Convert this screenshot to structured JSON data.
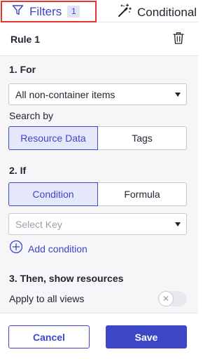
{
  "tabs": {
    "filters": {
      "label": "Filters",
      "count": "1",
      "icon": "funnel-icon"
    },
    "conditional": {
      "label": "Conditional",
      "icon": "magic-wand-icon"
    }
  },
  "rule": {
    "title": "Rule 1",
    "delete_icon": "trash-icon"
  },
  "section_for": {
    "title": "1. For",
    "select_value": "All non-container items",
    "search_by_label": "Search by",
    "search_by_options": [
      "Resource Data",
      "Tags"
    ],
    "search_by_selected": "Resource Data"
  },
  "section_if": {
    "title": "2. If",
    "mode_options": [
      "Condition",
      "Formula"
    ],
    "mode_selected": "Condition",
    "key_placeholder": "Select Key",
    "add_condition_label": "Add condition",
    "add_icon": "plus-circle-icon"
  },
  "section_then": {
    "title": "3. Then, show resources",
    "apply_all_label": "Apply to all views",
    "apply_all_enabled": false
  },
  "footer": {
    "cancel_label": "Cancel",
    "save_label": "Save"
  },
  "colors": {
    "accent": "#3d46c7",
    "highlight_border": "#e8332f",
    "panel_bg": "#f6f6f8"
  }
}
